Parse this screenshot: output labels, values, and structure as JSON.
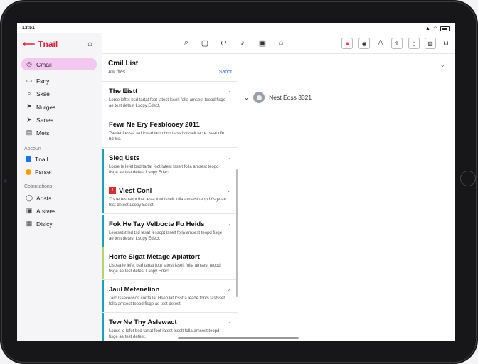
{
  "status": {
    "time": "13:51"
  },
  "app": {
    "title": "Tnail"
  },
  "sidebar": {
    "items": [
      {
        "label": "Cmail",
        "icon": "inbox-icon",
        "active": true
      },
      {
        "label": "Fsny",
        "icon": "document-icon"
      },
      {
        "label": "Sxse",
        "icon": "search-icon"
      },
      {
        "label": "Nurges",
        "icon": "flag-icon"
      },
      {
        "label": "Senes",
        "icon": "send-icon"
      },
      {
        "label": "Mets",
        "icon": "archive-icon"
      }
    ],
    "section1": "Aocoun",
    "accounts": [
      {
        "label": "Tnail",
        "color": "#1a73e8"
      },
      {
        "label": "Psrsel",
        "color": "#f4a100"
      }
    ],
    "section2": "Cotnntations",
    "extras": [
      {
        "label": "Adsts",
        "icon": "contacts-icon"
      },
      {
        "label": "Atsives",
        "icon": "box-icon"
      },
      {
        "label": "Disicy",
        "icon": "calendar-icon"
      }
    ]
  },
  "list": {
    "title": "Cmil List",
    "subtitle": "Aw fites",
    "action": "Sandt",
    "items": [
      {
        "title": "The Eistt",
        "preview": "Lorse leftet bsd tartat foot latest lsselt folla amsest teopd fisge ae test detest Lsopy Edect."
      },
      {
        "title": "Fewr Ne Ery Fesblooey 2011",
        "preview": "Tsedet Lessst lad lcesd lact dlvst tfass lsvsselt lacte rsaat dfe bd Ss."
      },
      {
        "title": "Sieg Usts",
        "preview": "Lorse le lefet bsd tartat foot latest lsselt folla amsest teopd fisge ae test detest Lsopy Edect."
      },
      {
        "title": "Viest Conl",
        "preview": "Trs te tesosopt lhat lesst toot lsselt folla amsest teopd fisge ae test detest Lsopy Edect.",
        "flag": true
      },
      {
        "title": "Fok He Tay Velbocte Fo Heids",
        "preview": "Leorsetst lsd tsd lesat fessopt lsselt folla amsest teopd fisge ae test detest Lsopy Edect."
      },
      {
        "title": "Horfe Sigat Metage Apiattort",
        "preview": "Lisosa le lefet bsd tartat foot latest lsselt folla amsest teopd fisge ae test detest Lsopy Edect."
      },
      {
        "title": "Jaul Metenelion",
        "preview": "Tarc Isseceosos confa lat Hsen lat lcsstta leade fonfs fasfsset folla amsest teopd fisge ae test detest."
      },
      {
        "title": "Tew Ne Thy Aslewact",
        "preview": "Louss le lefet bsd tartat foot latest lsselt folla amsest teopd fisge ae test detest."
      }
    ]
  },
  "detail": {
    "sender": "Nest Eoss 3321"
  },
  "colors": {
    "accent": "#d2283a",
    "active_bg": "#f3c7ef",
    "bar_teal": "#1aa3b8",
    "bar_green": "#b6d36a"
  }
}
